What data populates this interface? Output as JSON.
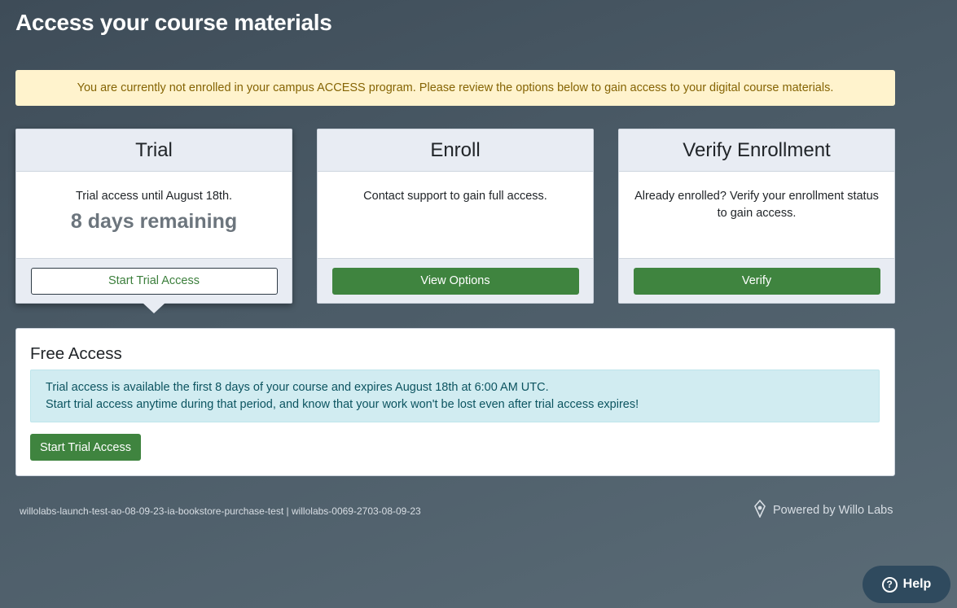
{
  "page": {
    "title": "Access your course materials"
  },
  "alert": {
    "message": "You are currently not enrolled in your campus ACCESS program. Please review the options below to gain access to your digital course materials."
  },
  "cards": {
    "trial": {
      "title": "Trial",
      "text": "Trial access until August 18th.",
      "remaining": "8 days remaining",
      "button": "Start Trial Access"
    },
    "enroll": {
      "title": "Enroll",
      "text": "Contact support to gain full access.",
      "button": "View Options"
    },
    "verify": {
      "title": "Verify Enrollment",
      "text": "Already enrolled? Verify your enrollment status to gain access.",
      "button": "Verify"
    }
  },
  "free_access": {
    "title": "Free Access",
    "info_line1": "Trial access is available the first 8 days of your course and expires August 18th at 6:00 AM UTC.",
    "info_line2": "Start trial access anytime during that period, and know that your work won't be lost even after trial access expires!",
    "button": "Start Trial Access"
  },
  "footer": {
    "ids": "willolabs-launch-test-ao-08-09-23-ia-bookstore-purchase-test | willolabs-0069-2703-08-09-23",
    "powered_by": "Powered by Willo Labs",
    "logo_icon": "willo-labs-logo-icon"
  },
  "help": {
    "label": "Help",
    "icon_glyph": "?",
    "icon": "question-circle-icon"
  },
  "colors": {
    "primary_green": "#3f843f",
    "alert_bg": "#fff3cd",
    "alert_text": "#856404",
    "info_bg": "#d1ecf1",
    "info_text": "#0c5460",
    "card_header_bg": "#e8ecf3",
    "help_bg": "#2f4a5e"
  }
}
